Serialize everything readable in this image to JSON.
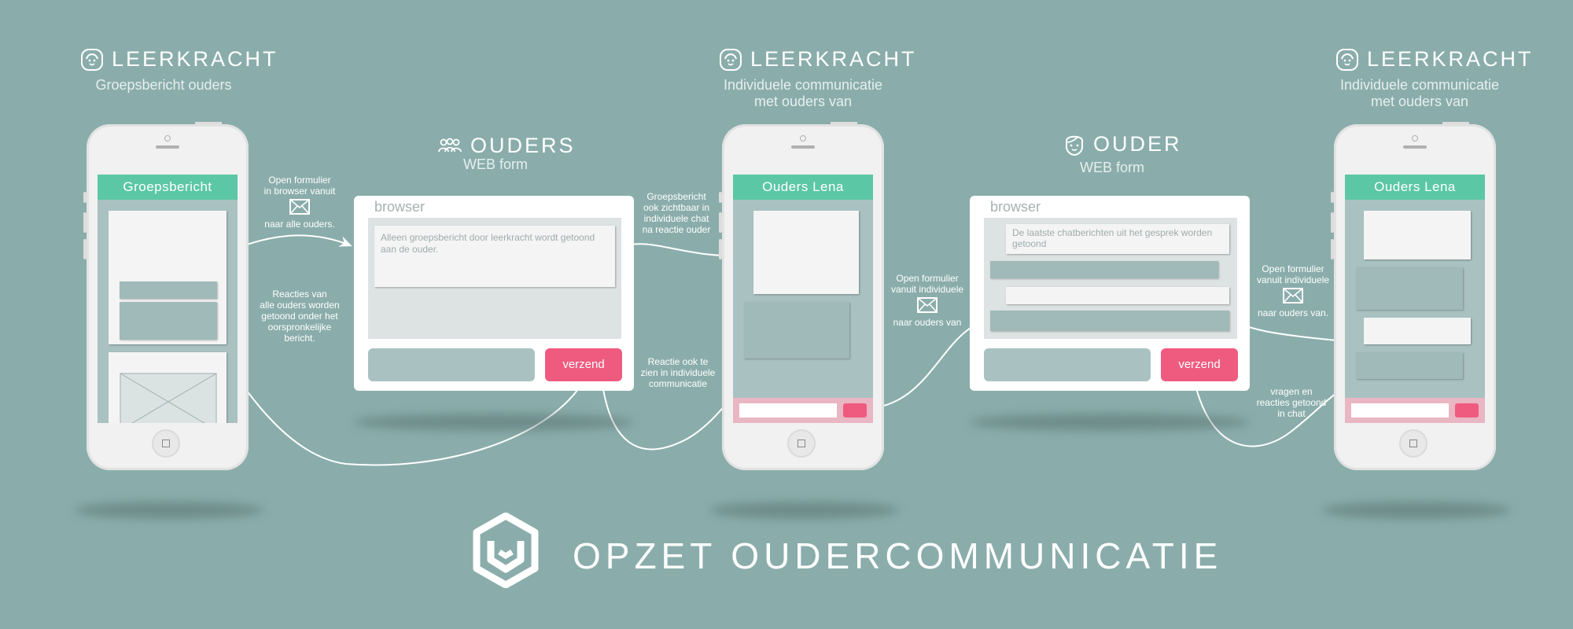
{
  "sections": {
    "s1": {
      "title": "LEERKRACHT",
      "subtitle": "Groepsbericht ouders"
    },
    "s2": {
      "title": "OUDERS",
      "subtitle": "WEB form"
    },
    "s3": {
      "title": "LEERKRACHT",
      "subtitle_line1": "Individuele communicatie",
      "subtitle_line2": "met  ouders van"
    },
    "s4": {
      "title": "OUDER",
      "subtitle": "WEB form"
    },
    "s5": {
      "title": "LEERKRACHT",
      "subtitle_line1": "Individuele communicatie",
      "subtitle_line2": "met  ouders van"
    }
  },
  "phones": {
    "p1": {
      "header": "Groepsbericht"
    },
    "p2": {
      "header": "Ouders Lena"
    },
    "p3": {
      "header": "Ouders Lena"
    }
  },
  "browsers": {
    "b1": {
      "label": "browser",
      "message": "Alleen groepsbericht door leerkracht wordt getoond aan de ouder.",
      "send": "verzend"
    },
    "b2": {
      "label": "browser",
      "message": "De laatste chatberichten uit het gesprek worden getoond",
      "send": "verzend"
    }
  },
  "notes": {
    "n1": [
      "Open formulier",
      "in browser vanuit"
    ],
    "n1b": "naar alle ouders.",
    "n2": [
      "Reacties van",
      "alle ouders worden",
      "getoond onder het",
      "oorspronkelijke",
      "bericht."
    ],
    "n3": [
      "Groepsbericht",
      "ook zichtbaar in",
      "individuele chat",
      "na reactie ouder"
    ],
    "n4": [
      "Reactie ook te",
      "zien in individuele",
      "communicatie"
    ],
    "n5": [
      "Open formulier",
      "vanuit individuele"
    ],
    "n5b": "naar ouders van",
    "n6": [
      "Open formulier",
      "vanuit individuele"
    ],
    "n6b": "naar ouders van.",
    "n7": [
      "vragen en",
      "reacties getoond",
      "in chat"
    ]
  },
  "footer": {
    "title": "OPZET  OUDERCOMMUNICATIE"
  },
  "colors": {
    "background": "#8aadab",
    "accent_green": "#5cc7a5",
    "accent_pink": "#ef5b7f"
  },
  "icons": [
    "teacher-face-icon",
    "parents-group-icon",
    "parent-face-icon",
    "envelope-icon",
    "logo-hexagon"
  ]
}
